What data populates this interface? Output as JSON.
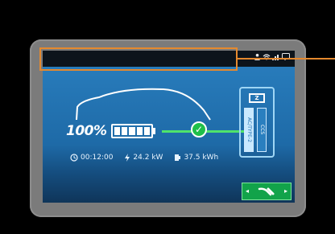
{
  "screen": {
    "charge_percent": "100%",
    "battery_level": 1.0,
    "charger_display": "Z",
    "plug_labels": [
      "AC/TYPE-2",
      "CCS"
    ],
    "stats": {
      "time": "00:12:00",
      "power": "24.2 kW",
      "energy": "37.5 kWh"
    }
  },
  "colors": {
    "background": "#000000",
    "bezel": "#7b7b7b",
    "screen_blue": "#2a7fbf",
    "status_bar": "#0d141b",
    "charge_green": "#4fe36b",
    "button_green": "#12a34a",
    "callout_orange": "#e5892e"
  },
  "icons": {
    "status": [
      "user-icon",
      "wifi-icon",
      "signal-icon",
      "speech-bubble-icon"
    ],
    "time": "clock-icon",
    "power": "lightning-icon",
    "energy": "plug-icon",
    "button": "charging-plug-icon"
  }
}
